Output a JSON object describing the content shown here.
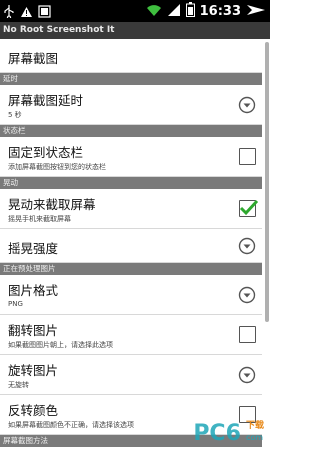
{
  "status_bar": {
    "time": "16:33"
  },
  "title_bar": {
    "title": "No Root Screenshot It"
  },
  "items": [
    {
      "title": "屏幕截图"
    },
    {
      "header": "延时"
    },
    {
      "title": "屏幕截图延时",
      "summary": "5 秒",
      "widget": "dropdown"
    },
    {
      "header": "状态栏"
    },
    {
      "title": "固定到状态栏",
      "summary": "添加屏幕截图按钮到您的状态栏",
      "widget": "checkbox",
      "checked": false
    },
    {
      "header": "晃动"
    },
    {
      "title": "晃动来截取屏幕",
      "summary": "摇晃手机来截取屏幕",
      "widget": "checkbox",
      "checked": true
    },
    {
      "title": "摇晃强度",
      "widget": "dropdown"
    },
    {
      "header": "正在预处理图片"
    },
    {
      "title": "图片格式",
      "summary": "PNG",
      "widget": "dropdown"
    },
    {
      "title": "翻转图片",
      "summary": "如果截图图片朝上，请选择此选项",
      "widget": "checkbox",
      "checked": false
    },
    {
      "title": "旋转图片",
      "summary": "无旋转",
      "widget": "dropdown"
    },
    {
      "title": "反转颜色",
      "summary": "如果屏幕截图颜色不正确，请选择该选项",
      "widget": "checkbox",
      "checked": false
    },
    {
      "header": "屏幕截图方法"
    }
  ],
  "watermark": {
    "brand": "PC6",
    "suffix": "下载",
    "domain": "com"
  },
  "colors": {
    "check_green": "#2ea82e",
    "header_bg": "#7a7a7a",
    "watermark_teal": "#1fa6b8"
  }
}
